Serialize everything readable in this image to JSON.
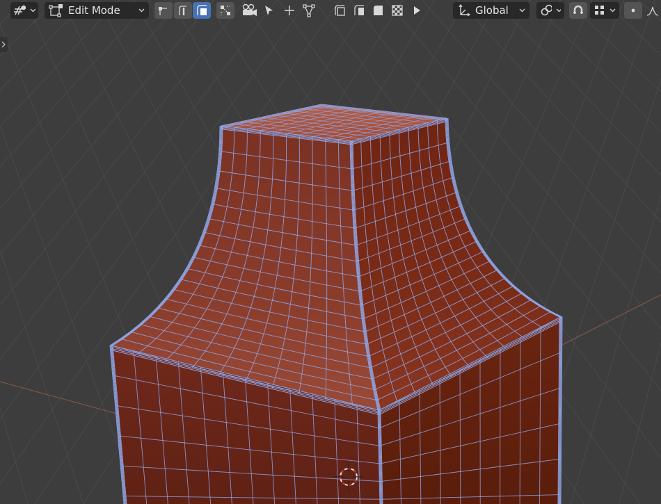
{
  "header": {
    "mode_selector": {
      "label": "Edit Mode"
    },
    "transform_orientation": {
      "label": "Global"
    }
  },
  "icons": {
    "editor_type": "viewport-gizmo-icon",
    "mode": "edit-mode-icon",
    "vertex_select": "vertex-select-icon",
    "edge_select": "edge-select-icon",
    "face_select": "face-select-icon",
    "view_toggle": "view-toggle-icon",
    "camera": "camera-gizmo-icon",
    "select_tool": "cursor-select-icon",
    "add_tool": "plus-icon",
    "vertex_tool": "vertex-tool-icon",
    "shading_1": "solid-shading-icon",
    "shading_2": "material-shading-icon",
    "shading_3": "rendered-shading-icon",
    "shading_4": "checker-shading-icon",
    "play": "play-icon",
    "orientation": "orientation-axes-icon",
    "pivot": "pivot-link-icon",
    "snap": "snap-magnet-icon",
    "snap_grid": "grid-snap-icon",
    "proportional": "proportional-edit-icon"
  },
  "colors": {
    "background": "#3d3d3d",
    "mesh_face": "#6e2a1c",
    "mesh_wire": "#8fa6e8",
    "active_button": "#4772b3",
    "grid": "#4a4a4a"
  }
}
